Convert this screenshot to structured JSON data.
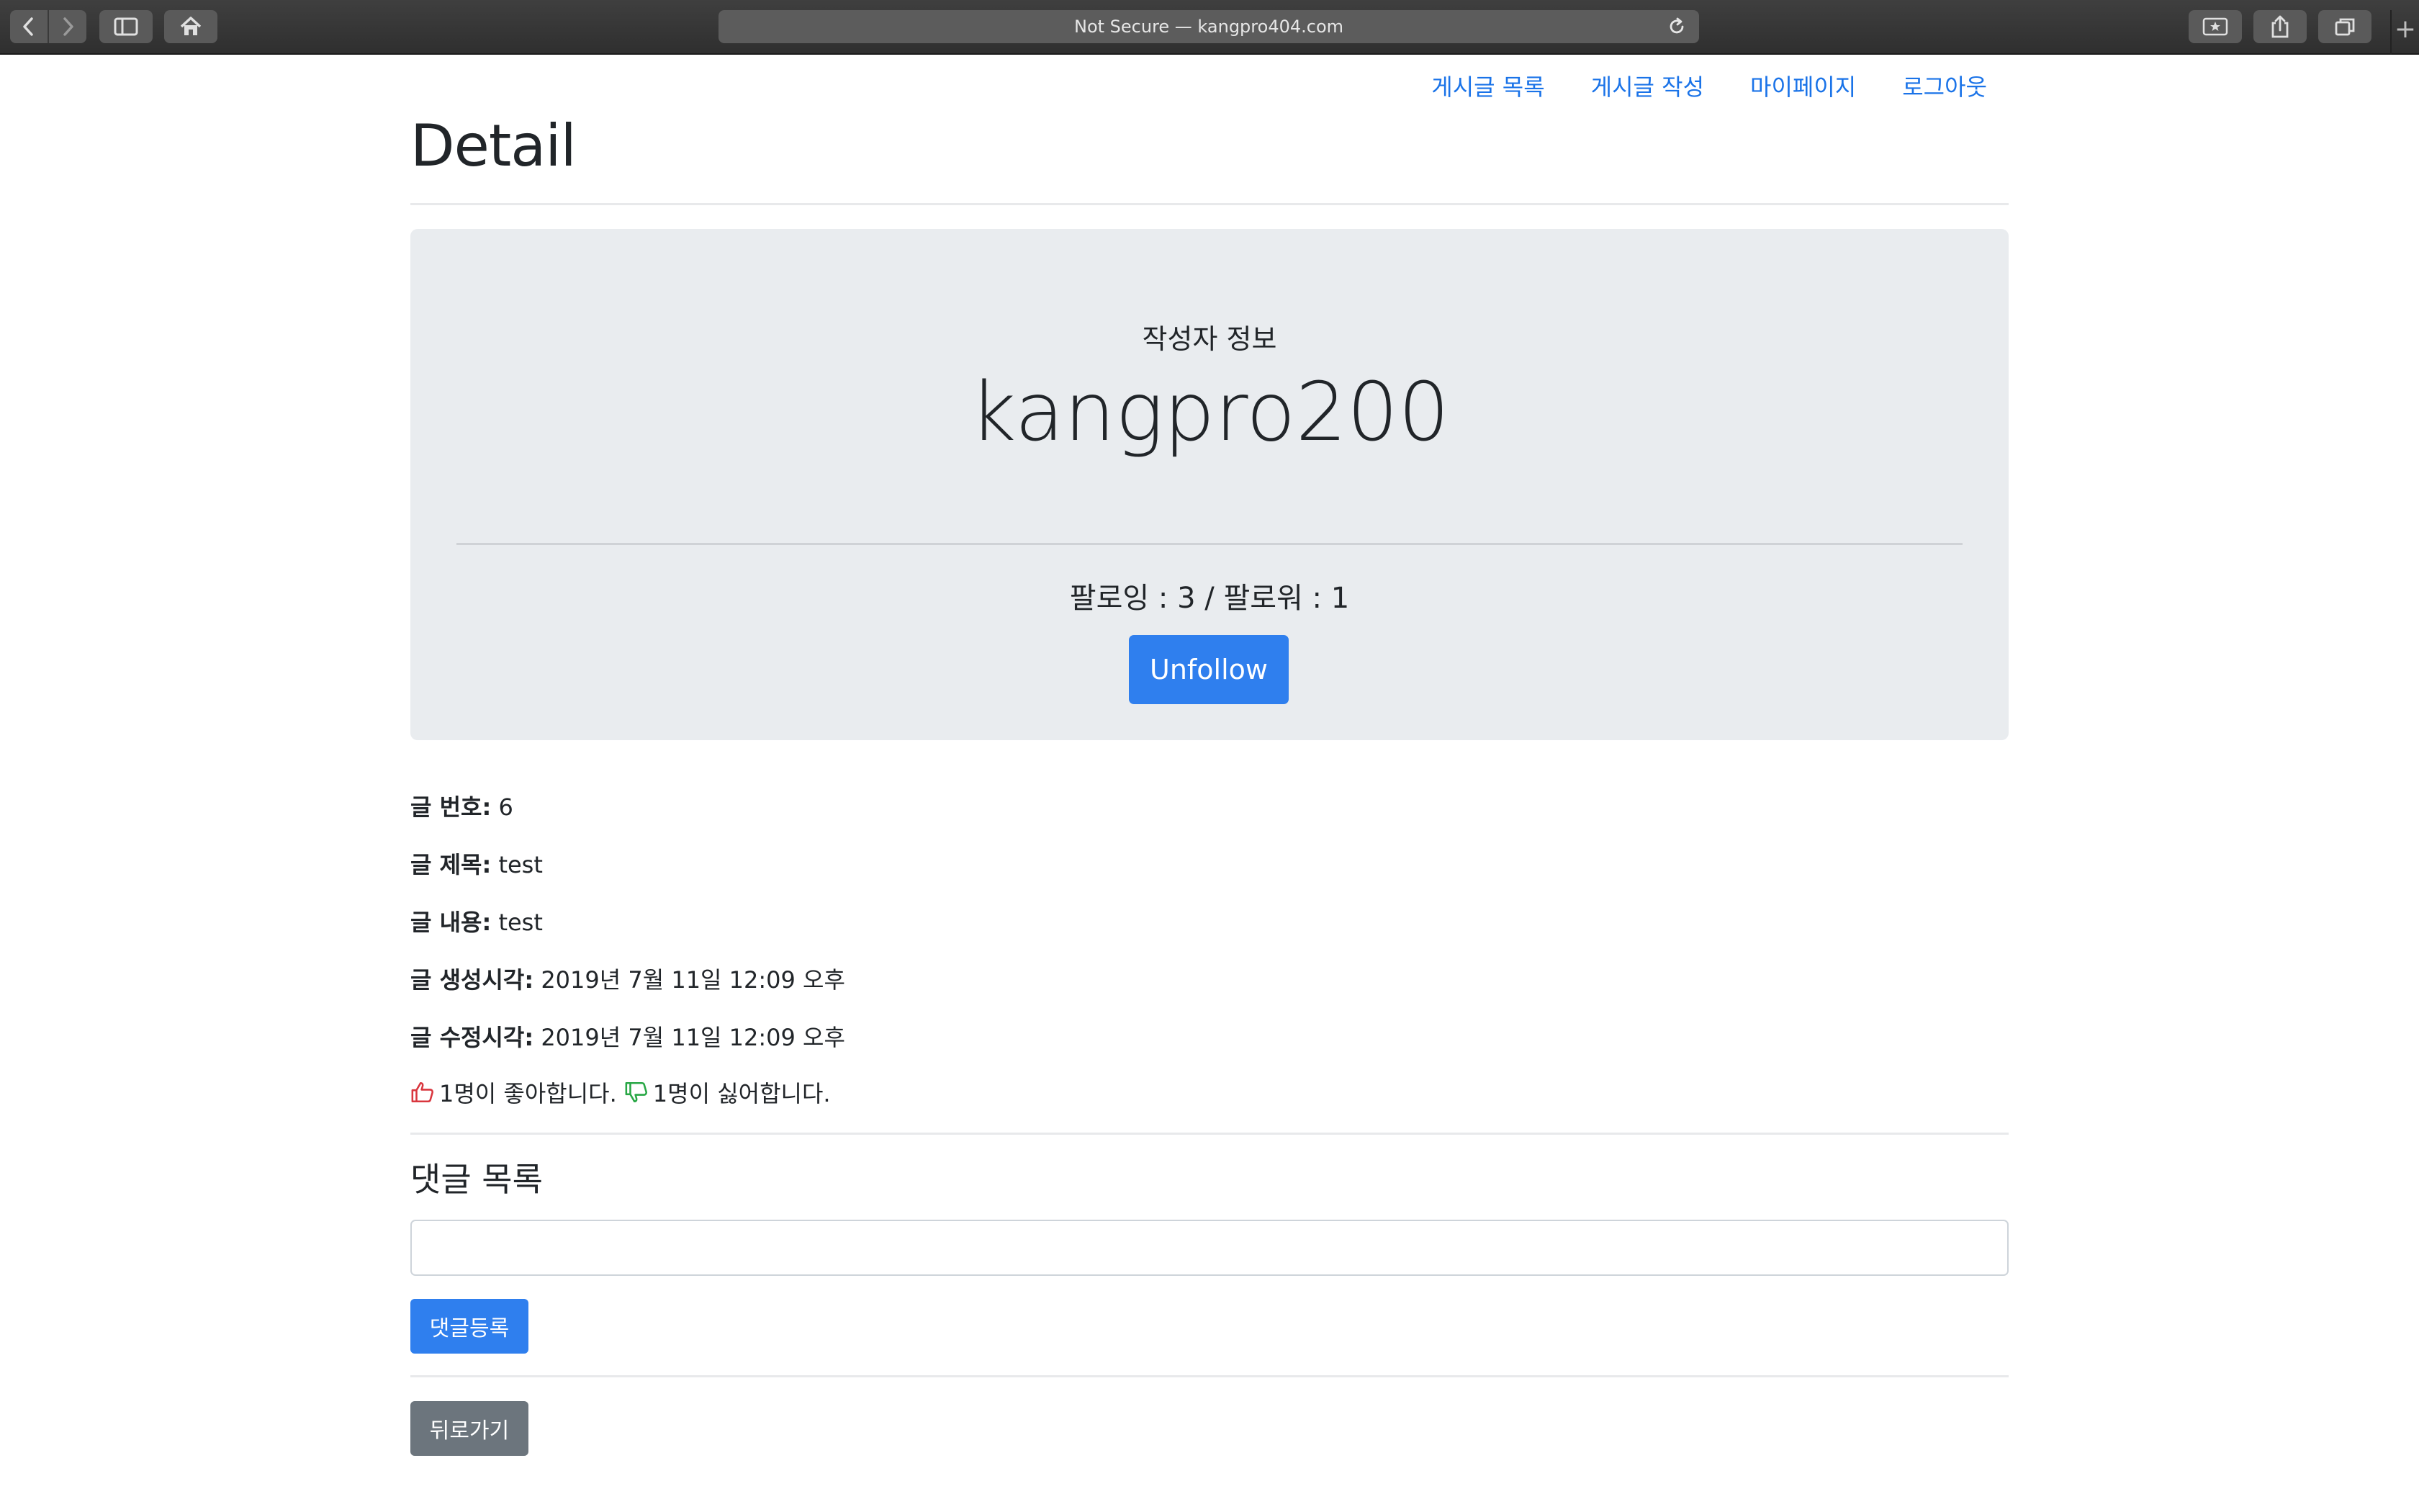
{
  "browser": {
    "url_text": "Not Secure — kangpro404.com",
    "new_tab_label": "+"
  },
  "nav": {
    "items": [
      {
        "label": "게시글 목록"
      },
      {
        "label": "게시글 작성"
      },
      {
        "label": "마이페이지"
      },
      {
        "label": "로그아웃"
      }
    ]
  },
  "page": {
    "title": "Detail"
  },
  "author": {
    "subtitle": "작성자 정보",
    "name": "kangpro200",
    "stats": "팔로잉 : 3 / 팔로워 : 1",
    "follow_button": "Unfollow"
  },
  "post": {
    "fields": [
      {
        "label": "글 번호:",
        "value": "6"
      },
      {
        "label": "글 제목:",
        "value": "test"
      },
      {
        "label": "글 내용:",
        "value": "test"
      },
      {
        "label": "글 생성시각:",
        "value": "2019년 7월 11일 12:09 오후"
      },
      {
        "label": "글 수정시각:",
        "value": "2019년 7월 11일 12:09 오후"
      }
    ],
    "likes_text": "1명이 좋아합니다.",
    "dislikes_text": "1명이 싫어합니다.",
    "like_color": "#d9363e",
    "dislike_color": "#28a745"
  },
  "comments": {
    "heading": "댓글 목록",
    "input_value": "",
    "submit_label": "댓글등록"
  },
  "footer": {
    "back_label": "뒤로가기"
  },
  "colors": {
    "primary": "#2f7fee",
    "secondary": "#6c757d",
    "link": "#1a73e8",
    "jumbotron": "#e9ecef"
  }
}
